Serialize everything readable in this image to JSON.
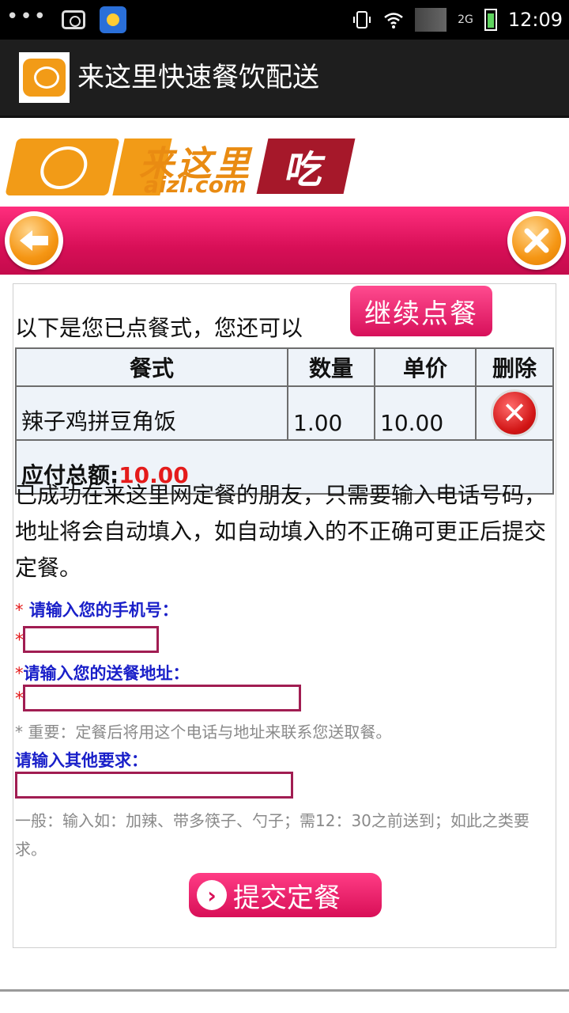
{
  "status_bar": {
    "time": "12:09",
    "network": "2G"
  },
  "app_bar": {
    "title": "来这里快速餐饮配送"
  },
  "logo": {
    "cn_text": "来这里",
    "en_text": "aizl.com",
    "eat_text": "吃"
  },
  "nav": {
    "back_icon": "arrow-left-icon",
    "close_icon": "close-icon"
  },
  "order": {
    "intro": "以下是您已点餐式，您还可以",
    "continue_label": "继续点餐",
    "headers": [
      "餐式",
      "数量",
      "单价",
      "删除"
    ],
    "items": [
      {
        "name": "辣子鸡拼豆角饭",
        "qty": "1.00",
        "price": "10.00"
      }
    ],
    "total_label": "应付总额:",
    "total_value": "10.00"
  },
  "info_text": "已成功在来这里网定餐的朋友，只需要输入电话号码，地址将会自动填入，如自动填入的不正确可更正后提交定餐。",
  "form": {
    "star": "*",
    "phone_label": "请输入您的手机号：",
    "address_label": "请输入您的送餐地址：",
    "important_note": "* 重要：定餐后将用这个电话与地址来联系您送取餐。",
    "other_label": "请输入其他要求：",
    "other_hint": "一般：输入如：加辣、带多筷子、勺子；需12：30之前送到；如此之类要求。",
    "submit_label": "提交定餐"
  },
  "colors": {
    "accent": "#d80f57",
    "logo_orange": "#f29b17",
    "total_red": "#e41b1b",
    "label_blue": "#1a20c9"
  }
}
